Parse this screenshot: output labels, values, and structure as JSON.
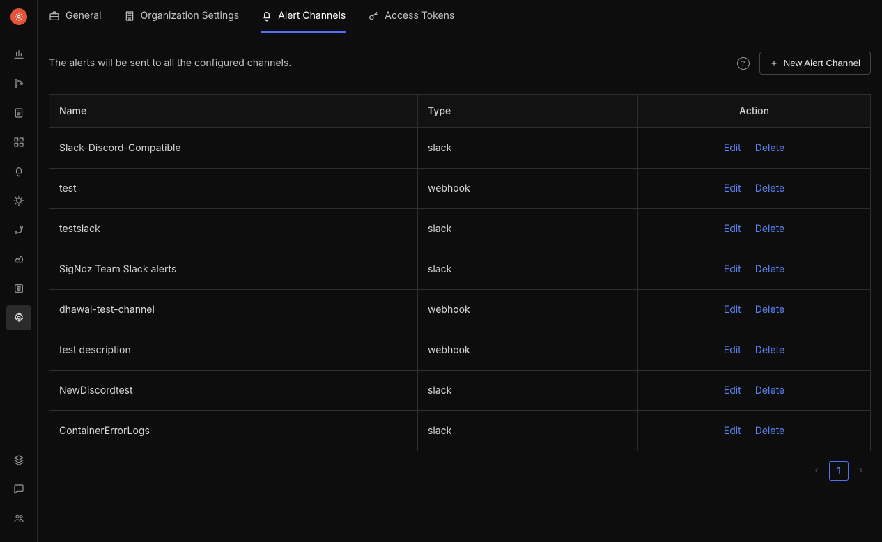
{
  "sidebar": {
    "items": [
      {
        "name": "metrics",
        "icon": "bar-chart-icon"
      },
      {
        "name": "traces",
        "icon": "branch-icon"
      },
      {
        "name": "logs",
        "icon": "scroll-icon"
      },
      {
        "name": "dashboards",
        "icon": "grid-icon"
      },
      {
        "name": "alerts",
        "icon": "bell-icon"
      },
      {
        "name": "exceptions",
        "icon": "bug-icon"
      },
      {
        "name": "pipeline",
        "icon": "route-icon"
      },
      {
        "name": "usage",
        "icon": "chart-area-icon"
      },
      {
        "name": "billing",
        "icon": "dollar-icon"
      },
      {
        "name": "settings",
        "icon": "gear-icon",
        "active": true
      }
    ],
    "bottom": [
      {
        "name": "layers",
        "icon": "layers-icon"
      },
      {
        "name": "feedback",
        "icon": "message-icon"
      },
      {
        "name": "invite",
        "icon": "users-icon"
      }
    ]
  },
  "tabs": [
    {
      "id": "general",
      "label": "General",
      "icon": "briefcase-icon"
    },
    {
      "id": "org",
      "label": "Organization Settings",
      "icon": "building-icon"
    },
    {
      "id": "alerts",
      "label": "Alert Channels",
      "icon": "bell-icon",
      "active": true
    },
    {
      "id": "tokens",
      "label": "Access Tokens",
      "icon": "key-icon"
    }
  ],
  "page": {
    "description": "The alerts will be sent to all the configured channels.",
    "new_button": "New Alert Channel"
  },
  "table": {
    "headers": {
      "name": "Name",
      "type": "Type",
      "action": "Action"
    },
    "action_edit": "Edit",
    "action_delete": "Delete",
    "rows": [
      {
        "name": "Slack-Discord-Compatible",
        "type": "slack"
      },
      {
        "name": "test",
        "type": "webhook"
      },
      {
        "name": "testslack",
        "type": "slack"
      },
      {
        "name": "SigNoz Team Slack alerts",
        "type": "slack"
      },
      {
        "name": "dhawal-test-channel",
        "type": "webhook"
      },
      {
        "name": "test description",
        "type": "webhook"
      },
      {
        "name": "NewDiscordtest",
        "type": "slack"
      },
      {
        "name": "ContainerErrorLogs",
        "type": "slack"
      }
    ]
  },
  "pagination": {
    "current": "1"
  }
}
